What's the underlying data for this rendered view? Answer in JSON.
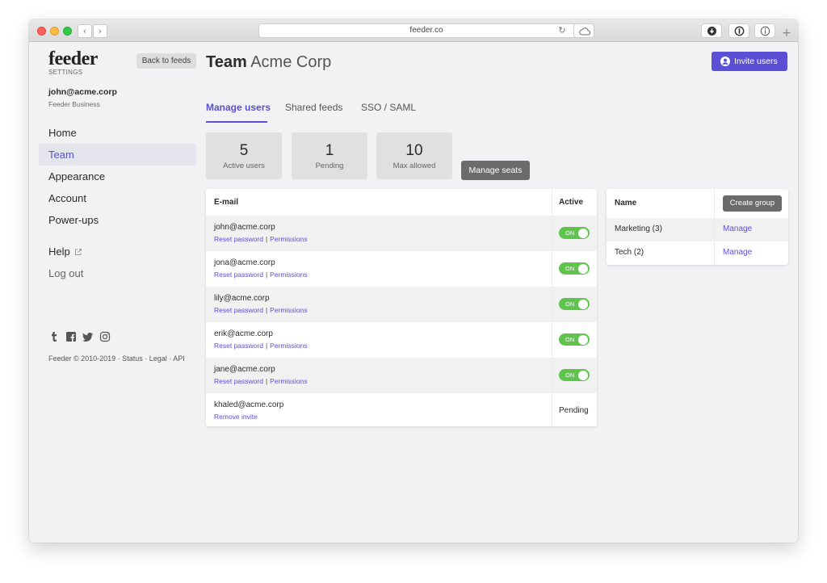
{
  "browser": {
    "url": "feeder.co",
    "back_glyph": "‹",
    "forward_glyph": "›",
    "reload_glyph": "↻",
    "new_tab_glyph": "+"
  },
  "brand": {
    "logo": "feeder",
    "subtitle": "SETTINGS",
    "accent_color": "#5b4fd6"
  },
  "sidebar": {
    "back_button": "Back to feeds",
    "user_email": "john@acme.corp",
    "user_plan": "Feeder Business",
    "items": [
      {
        "label": "Home"
      },
      {
        "label": "Team"
      },
      {
        "label": "Appearance"
      },
      {
        "label": "Account"
      },
      {
        "label": "Power-ups"
      }
    ],
    "help": "Help",
    "logout": "Log out",
    "social_icons": [
      "tumblr-icon",
      "facebook-icon",
      "twitter-icon",
      "instagram-icon"
    ],
    "footer": "Feeder © 2010-2019 · Status · Legal · API"
  },
  "header": {
    "title_bold": "Team",
    "title_rest": "Acme Corp",
    "invite_button": "Invite users"
  },
  "tabs": [
    {
      "label": "Manage users"
    },
    {
      "label": "Shared feeds"
    },
    {
      "label": "SSO / SAML"
    }
  ],
  "stats": [
    {
      "value": "5",
      "label": "Active users"
    },
    {
      "value": "1",
      "label": "Pending"
    },
    {
      "value": "10",
      "label": "Max allowed"
    }
  ],
  "manage_seats_button": "Manage seats",
  "users_table": {
    "columns": [
      "E-mail",
      "Active"
    ],
    "separator": "|",
    "rows": [
      {
        "email": "john@acme.corp",
        "link1": "Reset password",
        "link2": "Permissions",
        "status": "ON"
      },
      {
        "email": "jona@acme.corp",
        "link1": "Reset password",
        "link2": "Permissions",
        "status": "ON"
      },
      {
        "email": "lily@acme.corp",
        "link1": "Reset password",
        "link2": "Permissions",
        "status": "ON"
      },
      {
        "email": "erik@acme.corp",
        "link1": "Reset password",
        "link2": "Permissions",
        "status": "ON"
      },
      {
        "email": "jane@acme.corp",
        "link1": "Reset password",
        "link2": "Permissions",
        "status": "ON"
      },
      {
        "email": "khaled@acme.corp",
        "link1": "Remove invite",
        "status": "Pending"
      }
    ]
  },
  "groups_table": {
    "column": "Name",
    "create_button": "Create group",
    "rows": [
      {
        "name": "Marketing (3)",
        "action": "Manage"
      },
      {
        "name": "Tech (2)",
        "action": "Manage"
      }
    ]
  }
}
